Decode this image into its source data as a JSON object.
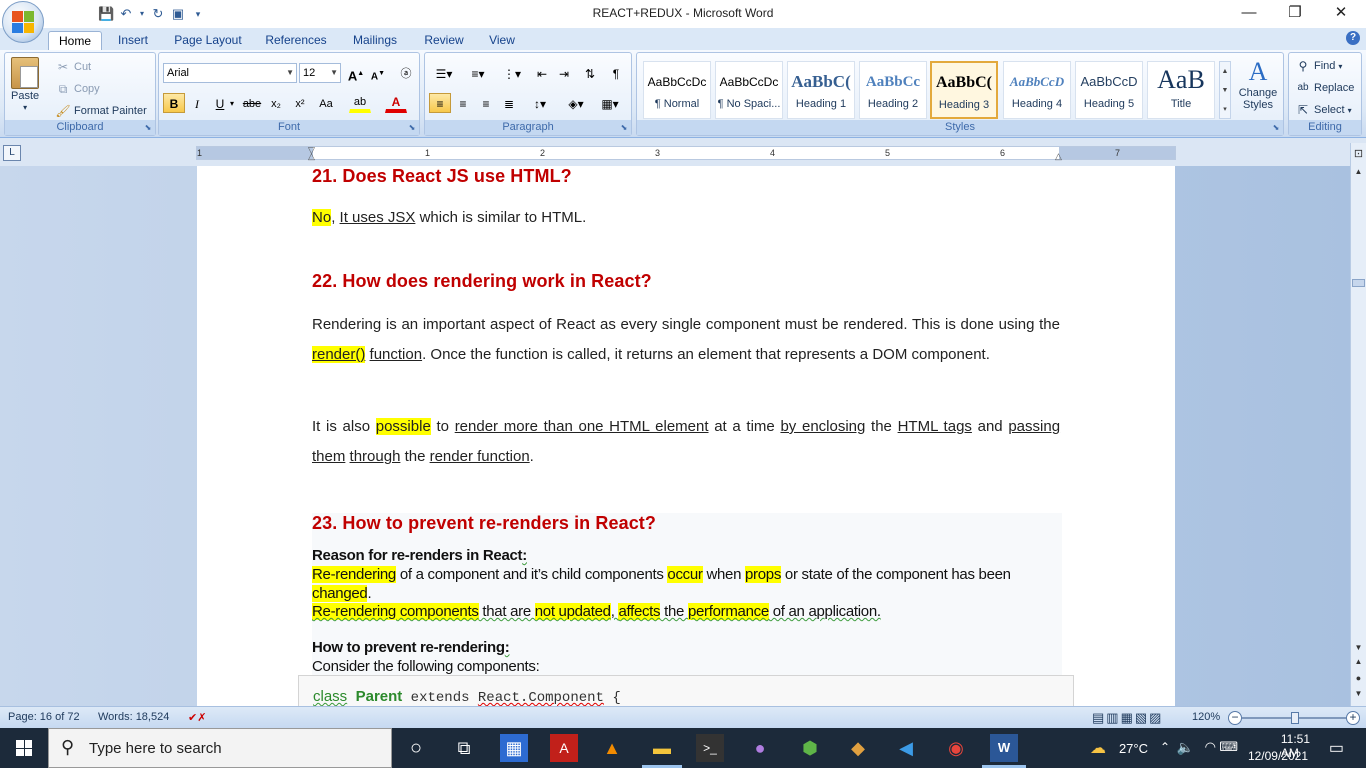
{
  "window": {
    "title": "REACT+REDUX - Microsoft Word",
    "minimize": "—",
    "restore": "❐",
    "close": "✕"
  },
  "ribbon_tabs": [
    "Home",
    "Insert",
    "Page Layout",
    "References",
    "Mailings",
    "Review",
    "View"
  ],
  "clipboard": {
    "paste": "Paste",
    "cut": "Cut",
    "copy": "Copy",
    "format_painter": "Format Painter",
    "label": "Clipboard"
  },
  "font": {
    "family": "Arial",
    "size": "12",
    "label": "Font",
    "grow": "A",
    "shrink": "A",
    "bold": "B",
    "italic": "I",
    "underline": "U",
    "strike": "abe",
    "subscript": "x₂",
    "superscript": "x²",
    "case": "Aa",
    "highlight": "ab",
    "color": "A"
  },
  "paragraph": {
    "label": "Paragraph"
  },
  "styles": {
    "label": "Styles",
    "items": [
      {
        "preview": "AaBbCcDc",
        "name": "¶ Normal"
      },
      {
        "preview": "AaBbCcDc",
        "name": "¶ No Spaci..."
      },
      {
        "preview": "AaBbC(",
        "name": "Heading 1"
      },
      {
        "preview": "AaBbCc",
        "name": "Heading 2"
      },
      {
        "preview": "AaBbC(",
        "name": "Heading 3"
      },
      {
        "preview": "AaBbCcD",
        "name": "Heading 4"
      },
      {
        "preview": "AaBbCcD",
        "name": "Heading 5"
      },
      {
        "preview": "AaB",
        "name": "Title"
      }
    ],
    "change_styles": "Change Styles"
  },
  "editing": {
    "label": "Editing",
    "find": "Find",
    "replace": "Replace",
    "select": "Select"
  },
  "ruler": {
    "tab_selector": "L",
    "numbers": [
      "1",
      "1",
      "2",
      "3",
      "4",
      "5",
      "6",
      "7"
    ]
  },
  "document": {
    "q21": {
      "title": "21. Does React JS use HTML?",
      "answer": [
        {
          "t": "No",
          "hl": true
        },
        {
          "t": ", "
        },
        {
          "t": "It uses JSX",
          "ul": true
        },
        {
          "t": " which is similar to HTML."
        }
      ]
    },
    "q22": {
      "title": "22. How does rendering work in React?",
      "p1a": "Rendering is an important aspect of React as every single component must be rendered. This is done using the ",
      "p1_render": "render()",
      "p1_mid": " ",
      "p1_function": "function",
      "p1b": ". Once the function is called, it returns an element that represents a DOM component.",
      "p2a": "It is also ",
      "p2_possible": "possible",
      "p2_to": " to ",
      "p2_render_more": "render more than one HTML element",
      "p2_at": " at a time ",
      "p2_by": "by enclosing",
      "p2_the": " the ",
      "p2_tags": "HTML tags",
      "p2_and": " and ",
      "p2_passing": "passing",
      "p2_sp1": " ",
      "p2_them": "them",
      "p2_sp2": " ",
      "p2_through": "through",
      "p2_the2": " the ",
      "p2_rf": "render function",
      "p2_end": "."
    },
    "q23": {
      "title": "23. How to prevent re-renders in React?",
      "reason_head": "Reason for re-renders in React",
      "reason_colon": ":",
      "l1_rerendering": "Re-rendering",
      "l1_a": " of a component and it’s child components ",
      "l1_occur": "occur",
      "l1_when": " when ",
      "l1_props": "props",
      "l1_b": " or state of the component has been ",
      "l1_changed": "changed",
      "l1_end": ".",
      "l2_rc": "Re-rendering components",
      "l2_that": " that are ",
      "l2_nu": "not updated",
      "l2_comma": ", ",
      "l2_aff": "affects",
      "l2_the": " the ",
      "l2_perf": "performance",
      "l2_end": " of an application.",
      "how_head": "How to prevent re-rendering",
      "how_colon": ":",
      "consider": "Consider the following components:"
    },
    "code": {
      "kw": "class",
      "name": "Parent",
      "ext": " extends ",
      "base": "React.Component",
      "brace": " {"
    }
  },
  "status": {
    "page": "Page: 16 of 72",
    "words": "Words: 18,524",
    "zoom": "120%",
    "zoom_out": "−",
    "zoom_in": "+"
  },
  "taskbar": {
    "search_placeholder": "Type here to search",
    "weather": "27°C",
    "time": "11:51 AM",
    "date": "12/09/2021"
  },
  "colors": {
    "heading_red": "#c00000",
    "highlight": "#ffff00",
    "ribbon_blue": "#dbe8f7",
    "taskbar": "#1c2a3a"
  }
}
